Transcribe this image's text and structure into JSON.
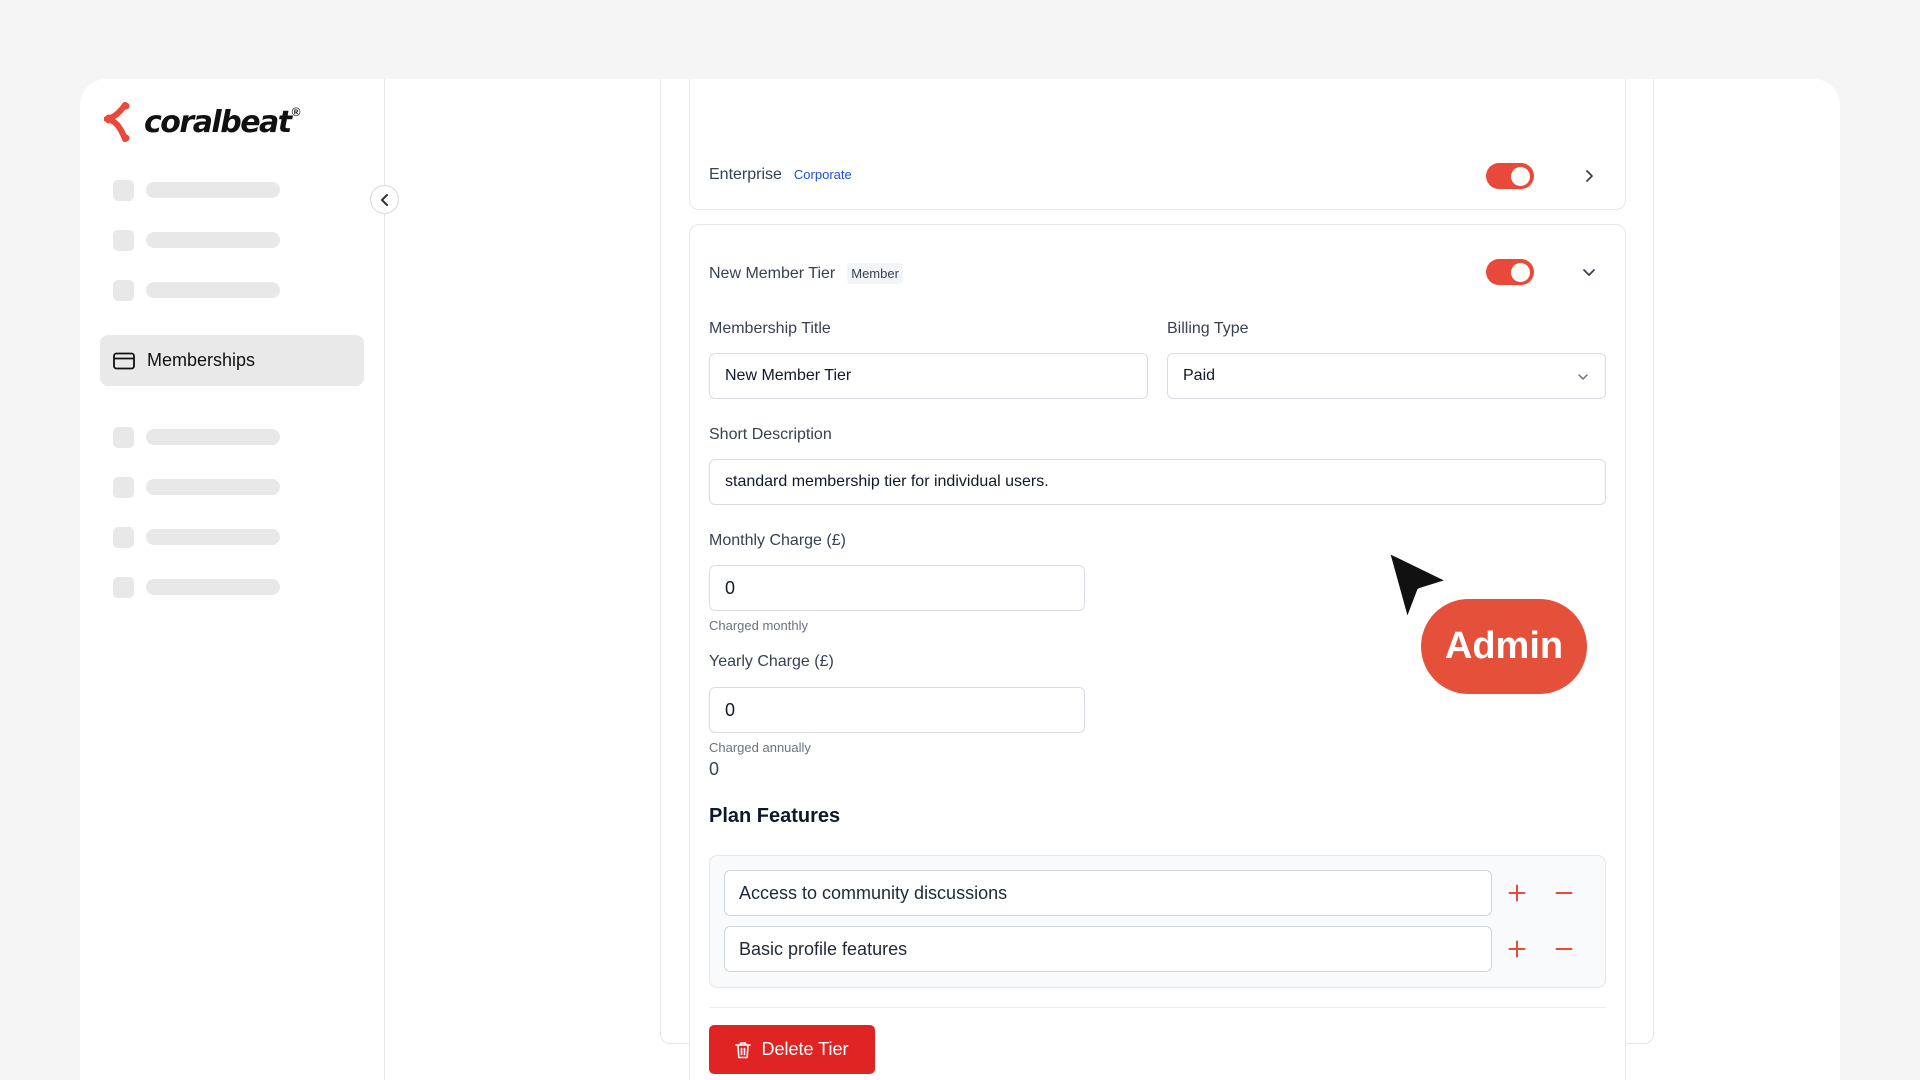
{
  "brand": {
    "name": "coralbeat",
    "reg": "®",
    "accent": "#e8493a"
  },
  "sidebar": {
    "collapse_icon": "chevron-left-icon",
    "items": [
      {
        "type": "skeleton"
      },
      {
        "type": "skeleton"
      },
      {
        "type": "skeleton"
      },
      {
        "type": "active",
        "label": "Memberships",
        "icon": "credit-card-icon"
      },
      {
        "type": "skeleton"
      },
      {
        "type": "skeleton"
      },
      {
        "type": "skeleton"
      },
      {
        "type": "skeleton"
      }
    ]
  },
  "tiers": {
    "enterprise": {
      "name": "Enterprise",
      "badge": "Corporate",
      "enabled": true,
      "expand_icon": "chevron-right-icon"
    },
    "new_member": {
      "name": "New Member Tier",
      "badge": "Member",
      "enabled": true,
      "expand_icon": "chevron-down-icon",
      "form": {
        "title_label": "Membership Title",
        "title_value": "New Member Tier",
        "billing_label": "Billing Type",
        "billing_value": "Paid",
        "desc_label": "Short Description",
        "desc_value": "standard membership tier for individual users.",
        "monthly_label": "Monthly Charge (£)",
        "monthly_value": "0",
        "monthly_hint": "Charged monthly",
        "yearly_label": "Yearly Charge (£)",
        "yearly_value": "0",
        "yearly_hint": "Charged annually",
        "yearly_extra": "0"
      },
      "features_title": "Plan Features",
      "features": [
        "Access to community discussions",
        "Basic profile features"
      ],
      "delete_label": "Delete Tier"
    }
  },
  "overlay": {
    "role_label": "Admin"
  }
}
